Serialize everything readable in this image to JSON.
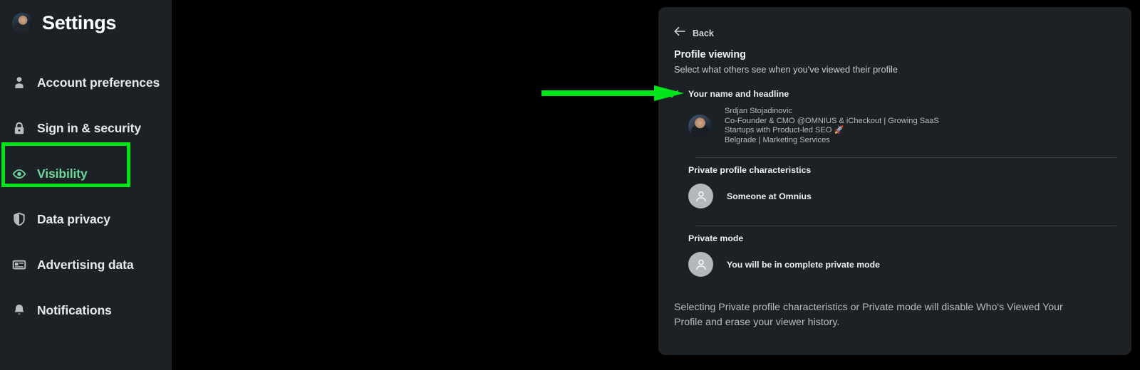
{
  "sidebar": {
    "brand": {
      "title": "Settings",
      "avatar_icon": "user-photo-avatar"
    },
    "items": [
      {
        "label": "Account preferences",
        "icon": "person-icon",
        "active": false
      },
      {
        "label": "Sign in & security",
        "icon": "lock-icon",
        "active": false
      },
      {
        "label": "Visibility",
        "icon": "eye-icon",
        "active": true
      },
      {
        "label": "Data privacy",
        "icon": "shield-icon",
        "active": false
      },
      {
        "label": "Advertising data",
        "icon": "ad-card-icon",
        "active": false
      },
      {
        "label": "Notifications",
        "icon": "bell-icon",
        "active": false
      }
    ]
  },
  "annotations": {
    "arrow_color": "#00e519",
    "highlight_color": "#00e519"
  },
  "panel": {
    "back_label": "Back",
    "back_icon": "arrow-left-icon",
    "title": "Profile viewing",
    "subtitle": "Select what others see when you've viewed their profile",
    "options": [
      {
        "label": "Your name and headline",
        "selected": true,
        "check_icon": "check-icon",
        "check_color": "#5dbd8d",
        "avatar_icon": "user-photo-avatar",
        "profile_name": "Srdjan Stojadinovic",
        "profile_headline": "Co-Founder & CMO @OMNIUS & iCheckout | Growing SaaS Startups with Product-led SEO 🚀",
        "profile_location": "Belgrade | Marketing Services"
      },
      {
        "label": "Private profile characteristics",
        "selected": false,
        "avatar_icon": "generic-person-avatar",
        "row_text": "Someone at Omnius"
      },
      {
        "label": "Private mode",
        "selected": false,
        "avatar_icon": "generic-person-avatar",
        "row_text": "You will be in complete private mode"
      }
    ],
    "footer_note": "Selecting Private profile characteristics or Private mode will disable Who's Viewed Your Profile and erase your viewer history."
  }
}
